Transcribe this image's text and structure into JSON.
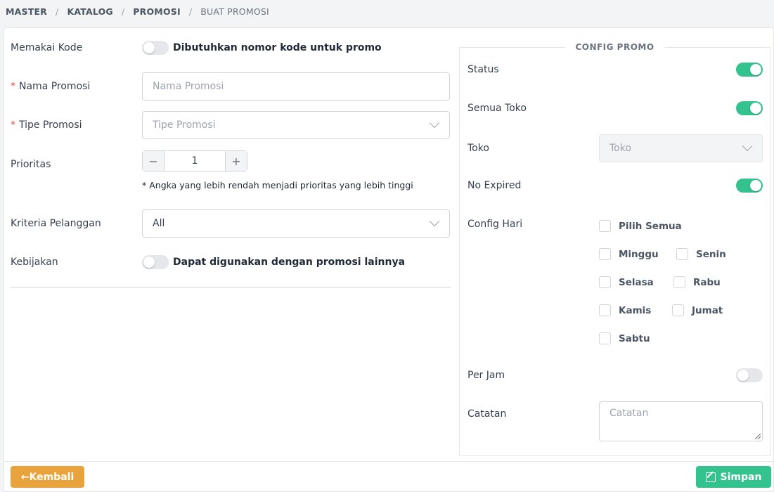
{
  "breadcrumb": {
    "items": [
      "MASTER",
      "KATALOG",
      "PROMOSI"
    ],
    "current": "BUAT PROMOSI",
    "separator": "/"
  },
  "form": {
    "memakai_kode": {
      "label": "Memakai Kode",
      "toggle_text": "Dibutuhkan nomor kode untuk promo"
    },
    "nama_promosi": {
      "label": "Nama Promosi",
      "placeholder": "Nama Promosi"
    },
    "tipe_promosi": {
      "label": "Tipe Promosi",
      "placeholder": "Tipe Promosi"
    },
    "prioritas": {
      "label": "Prioritas",
      "value": "1",
      "minus": "−",
      "plus": "+",
      "hint": "* Angka yang lebih rendah menjadi prioritas yang lebih tinggi"
    },
    "kriteria": {
      "label": "Kriteria Pelanggan",
      "value": "All"
    },
    "kebijakan": {
      "label": "Kebijakan",
      "toggle_text": "Dapat digunakan dengan promosi lainnya"
    },
    "required_mark": "*"
  },
  "config": {
    "title": "CONFIG PROMO",
    "status": {
      "label": "Status",
      "on": true
    },
    "semua_toko": {
      "label": "Semua Toko",
      "on": true
    },
    "toko": {
      "label": "Toko",
      "placeholder": "Toko"
    },
    "no_expired": {
      "label": "No Expired",
      "on": true
    },
    "config_hari": {
      "label": "Config Hari",
      "pilih_semua": "Pilih Semua",
      "days": [
        "Minggu",
        "Senin",
        "Selasa",
        "Rabu",
        "Kamis",
        "Jumat",
        "Sabtu"
      ]
    },
    "per_jam": {
      "label": "Per Jam",
      "on": false
    },
    "catatan": {
      "label": "Catatan",
      "placeholder": "Catatan"
    }
  },
  "actions": {
    "back_label": "Kembali",
    "back_arrow": "←",
    "save_label": "Simpan"
  },
  "colors": {
    "primary_green": "#34c38f",
    "back_orange": "#e8a33d",
    "required_red": "#ef4444"
  }
}
